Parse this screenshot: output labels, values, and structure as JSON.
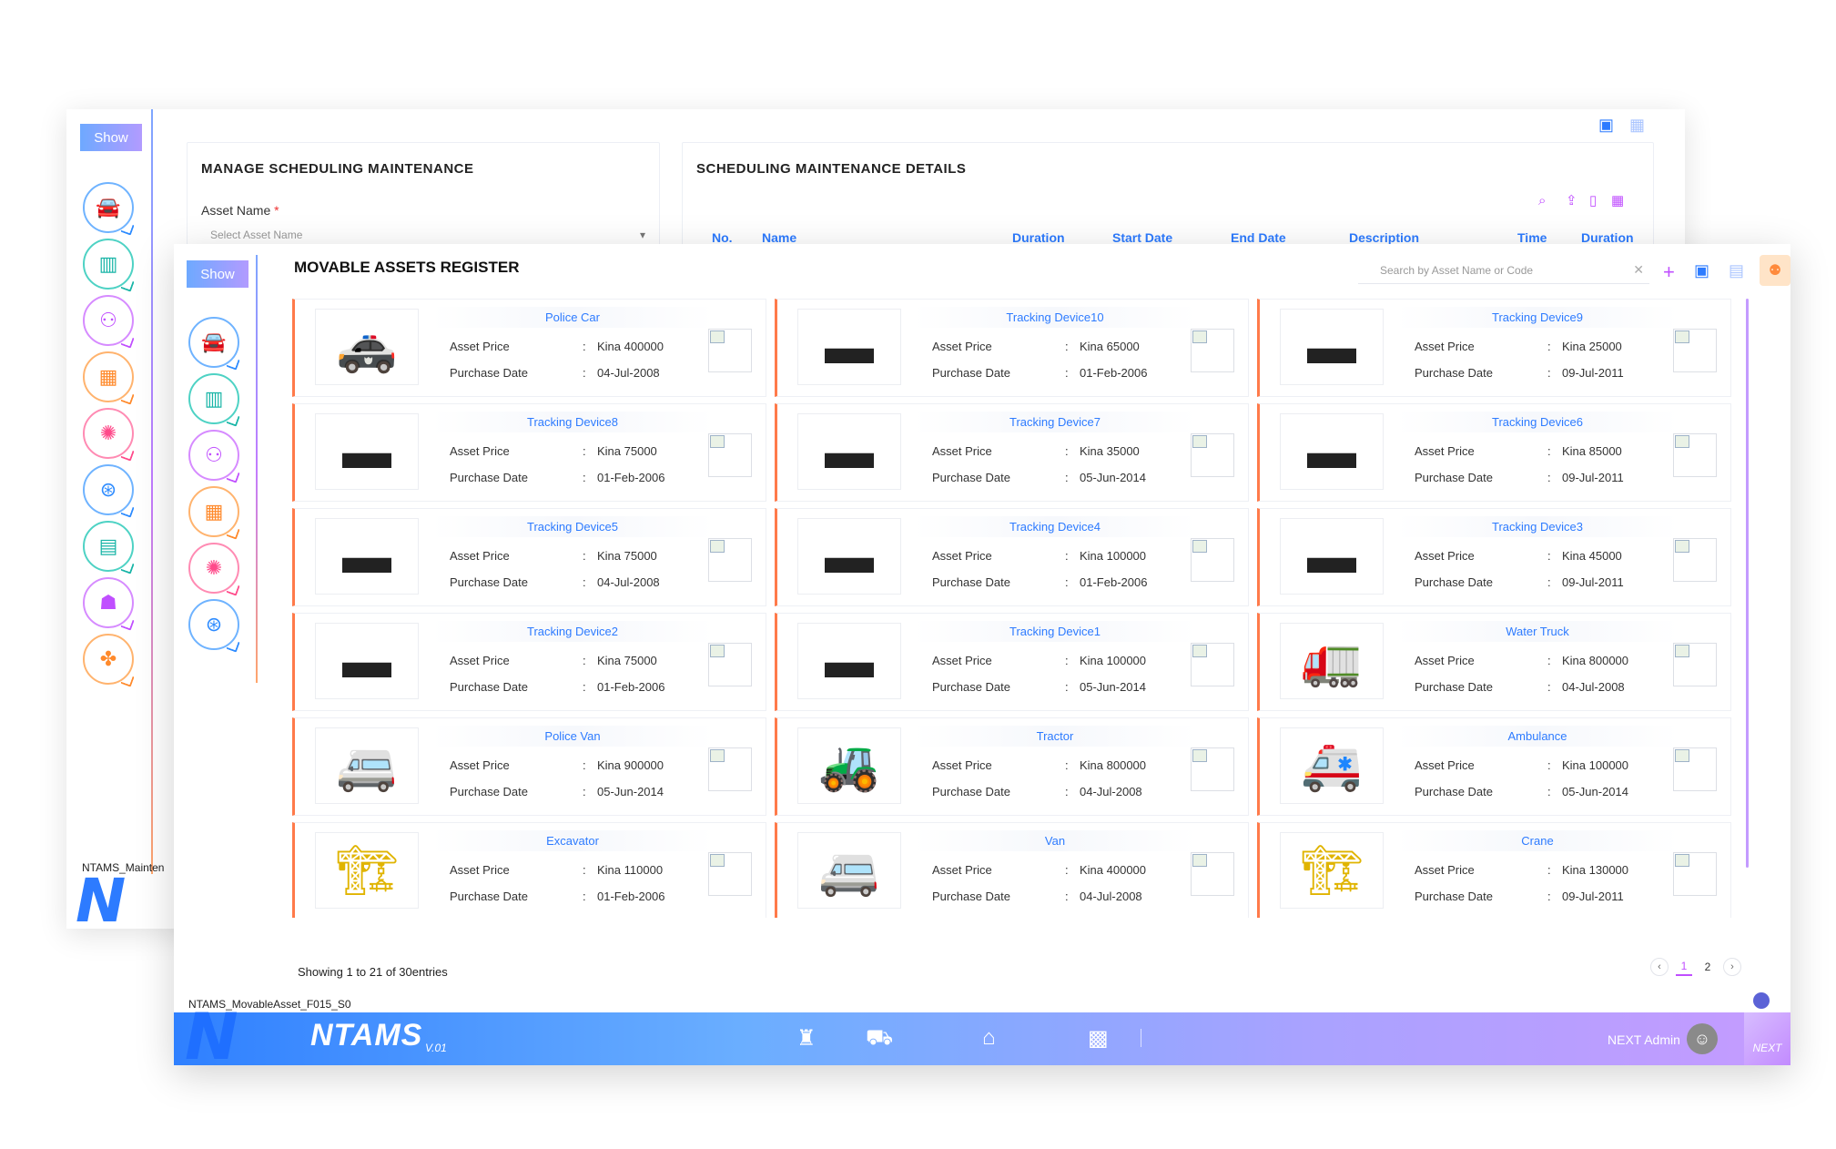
{
  "back_window": {
    "show_label": "Show",
    "panel_left_title": "MANAGE SCHEDULING MAINTENANCE",
    "asset_name_label": "Asset Name",
    "required_mark": "*",
    "asset_name_placeholder": "Select Asset Name",
    "panel_right_title": "SCHEDULING MAINTENANCE DETAILS",
    "table_headers": [
      "No.",
      "Name",
      "Duration",
      "Start Date",
      "End Date",
      "Description",
      "Time",
      "Duration"
    ],
    "footer_code": "NTAMS_Mainten"
  },
  "front_window": {
    "show_label": "Show",
    "page_title": "MOVABLE ASSETS REGISTER",
    "search_placeholder": "Search by Asset Name or Code",
    "field_labels": {
      "price": "Asset Price",
      "date": "Purchase Date",
      "colon": ":"
    },
    "assets": [
      {
        "name": "Police Car",
        "price": "Kina 400000",
        "date": "04-Jul-2008",
        "icon": "police-car"
      },
      {
        "name": "Tracking Device10",
        "price": "Kina 65000",
        "date": "01-Feb-2006",
        "icon": "tracking-device"
      },
      {
        "name": "Tracking Device9",
        "price": "Kina 25000",
        "date": "09-Jul-2011",
        "icon": "tracking-device"
      },
      {
        "name": "Tracking Device8",
        "price": "Kina 75000",
        "date": "01-Feb-2006",
        "icon": "tracking-device"
      },
      {
        "name": "Tracking Device7",
        "price": "Kina 35000",
        "date": "05-Jun-2014",
        "icon": "tracking-device"
      },
      {
        "name": "Tracking Device6",
        "price": "Kina 85000",
        "date": "09-Jul-2011",
        "icon": "tracking-device"
      },
      {
        "name": "Tracking Device5",
        "price": "Kina 75000",
        "date": "04-Jul-2008",
        "icon": "tracking-device"
      },
      {
        "name": "Tracking Device4",
        "price": "Kina 100000",
        "date": "01-Feb-2006",
        "icon": "tracking-device"
      },
      {
        "name": "Tracking Device3",
        "price": "Kina 45000",
        "date": "09-Jul-2011",
        "icon": "tracking-device"
      },
      {
        "name": "Tracking Device2",
        "price": "Kina 75000",
        "date": "01-Feb-2006",
        "icon": "tracking-device"
      },
      {
        "name": "Tracking Device1",
        "price": "Kina 100000",
        "date": "05-Jun-2014",
        "icon": "tracking-device"
      },
      {
        "name": "Water Truck",
        "price": "Kina 800000",
        "date": "04-Jul-2008",
        "icon": "water-truck"
      },
      {
        "name": "Police Van",
        "price": "Kina 900000",
        "date": "05-Jun-2014",
        "icon": "police-van"
      },
      {
        "name": "Tractor",
        "price": "Kina 800000",
        "date": "04-Jul-2008",
        "icon": "tractor"
      },
      {
        "name": "Ambulance",
        "price": "Kina 100000",
        "date": "05-Jun-2014",
        "icon": "ambulance"
      },
      {
        "name": "Excavator",
        "price": "Kina 110000",
        "date": "01-Feb-2006",
        "icon": "excavator"
      },
      {
        "name": "Van",
        "price": "Kina 400000",
        "date": "04-Jul-2008",
        "icon": "van"
      },
      {
        "name": "Crane",
        "price": "Kina 130000",
        "date": "09-Jul-2011",
        "icon": "crane"
      }
    ],
    "showing_text": "Showing 1 to 21 of 30entries",
    "pages": [
      "1",
      "2"
    ],
    "current_page": "1",
    "footer_code": "NTAMS_MovableAsset_F015_S0",
    "brand": "NTAMS",
    "version": "V.01",
    "admin_name": "NEXT Admin",
    "corner_text": "NEXT"
  },
  "colors": {
    "accent_blue": "#2d7bff",
    "card_border_orange": "#ff7a4a",
    "pager_active": "#c04fff"
  }
}
